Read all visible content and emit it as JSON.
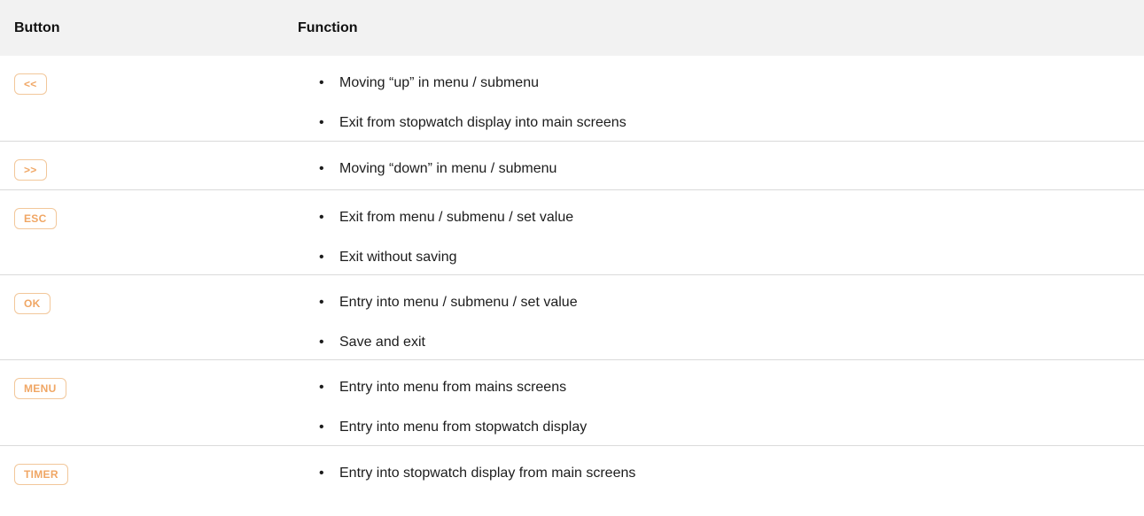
{
  "header": {
    "button_col": "Button",
    "function_col": "Function"
  },
  "rows": [
    {
      "key": "<<",
      "functions": [
        "Moving “up” in menu / submenu",
        "Exit from stopwatch display into main screens"
      ]
    },
    {
      "key": ">>",
      "functions": [
        "Moving “down” in menu / submenu"
      ]
    },
    {
      "key": "ESC",
      "functions": [
        "Exit from menu / submenu / set value",
        "Exit without saving"
      ]
    },
    {
      "key": "OK",
      "functions": [
        "Entry into menu / submenu / set value",
        "Save and exit"
      ]
    },
    {
      "key": "MENU",
      "functions": [
        "Entry into menu from mains screens",
        "Entry into menu from stopwatch display"
      ]
    },
    {
      "key": "TIMER",
      "functions": [
        "Entry into stopwatch display from main screens"
      ]
    }
  ],
  "colors": {
    "key_border": "#f2c79a",
    "key_text": "#f0a664",
    "header_bg": "#f2f2f2"
  }
}
